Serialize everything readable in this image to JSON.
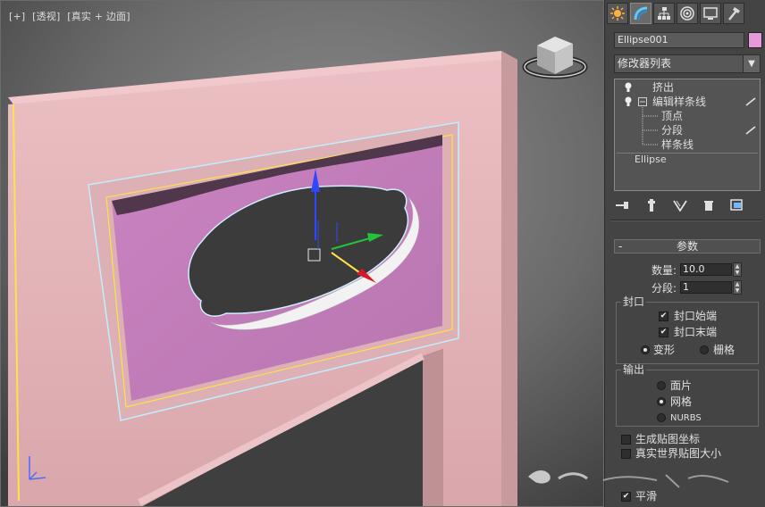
{
  "viewport": {
    "label_parts": [
      "[+]",
      "[透视]",
      "[真实 + 边面]"
    ],
    "object_color": "#e6b4b8",
    "inner_panel_color": "#c97fbf",
    "hole_color": "#3b3b3b",
    "selection_color": "#ffe14a"
  },
  "command_panel": {
    "tabs": [
      {
        "icon": "sun-create-icon"
      },
      {
        "icon": "modify-arc-icon"
      },
      {
        "icon": "hierarchy-icon"
      },
      {
        "icon": "motion-icon"
      },
      {
        "icon": "display-monitor-icon"
      },
      {
        "icon": "utilities-hammer-icon"
      }
    ],
    "object_name": "Ellipse001",
    "object_color": "#e59ad9",
    "modifier_list_label": "修改器列表",
    "stack": {
      "extrude": "挤出",
      "edit_spline": "编辑样条线",
      "vertex": "顶点",
      "segment": "分段",
      "spline": "样条线",
      "base": "Ellipse"
    },
    "params": {
      "title": "参数",
      "amount_label": "数量:",
      "amount_value": "10.0",
      "segments_label": "分段:",
      "segments_value": "1",
      "capping_title": "封口",
      "cap_start": "封口始端",
      "cap_end": "封口末端",
      "morph": "变形",
      "grid": "栅格",
      "output_title": "输出",
      "patch": "面片",
      "mesh": "网格",
      "nurbs": "NURBS",
      "gen_map_coords": "生成贴图坐标",
      "real_world_map": "真实世界贴图大小",
      "smooth": "平滑"
    }
  }
}
